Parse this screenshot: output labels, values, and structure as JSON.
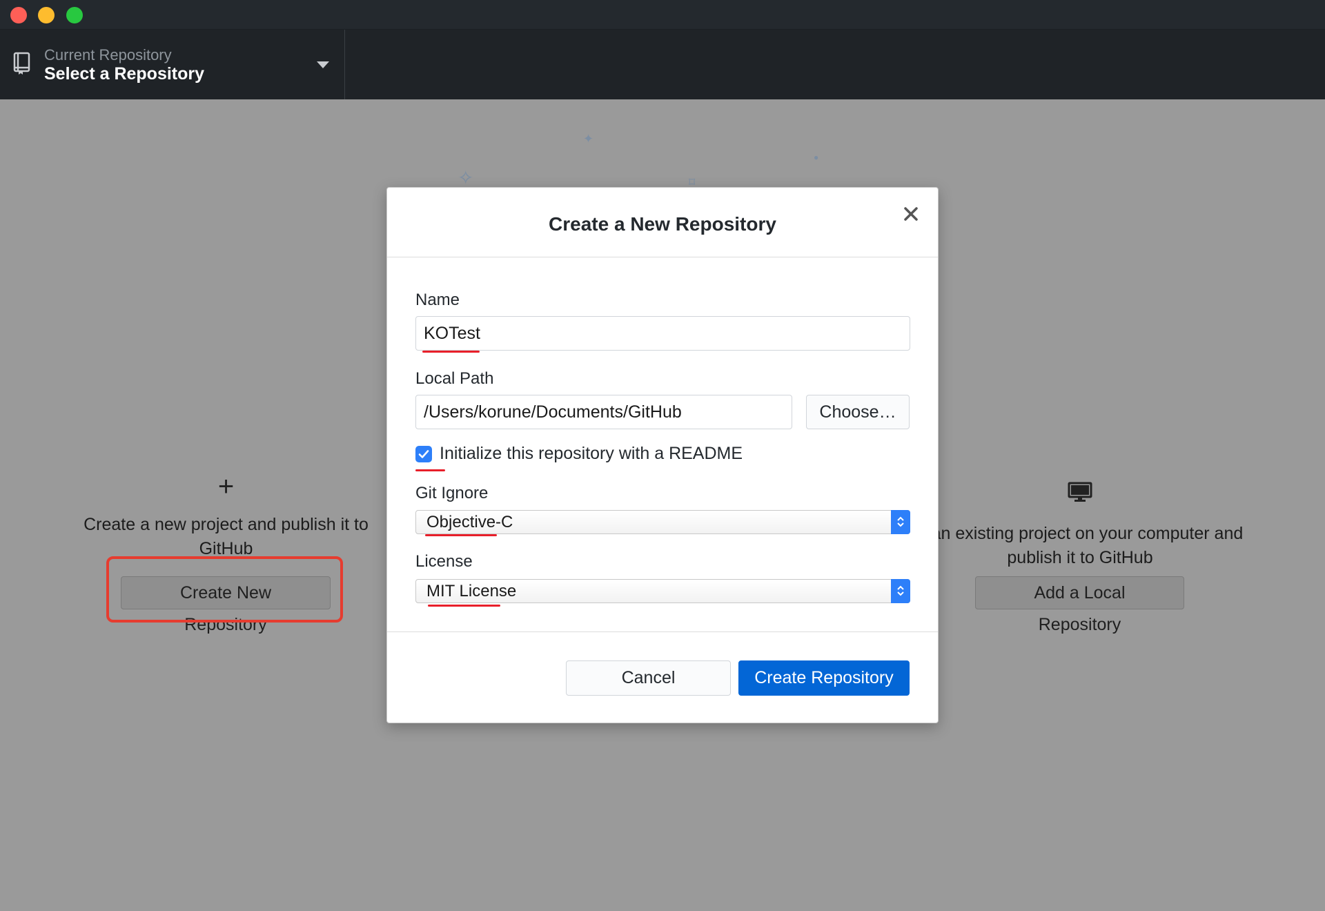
{
  "toolbar": {
    "repo_caption": "Current Repository",
    "repo_title": "Select a Repository"
  },
  "blank_slate": {
    "left": {
      "description": "Create a new project and publish it to GitHub",
      "button_label": "Create New Repository"
    },
    "right": {
      "description": "d an existing project on your computer and publish it to GitHub",
      "button_label": "Add a Local Repository"
    }
  },
  "dialog": {
    "title": "Create a New Repository",
    "name_label": "Name",
    "name_value": "KOTest",
    "path_label": "Local Path",
    "path_value": "/Users/korune/Documents/GitHub",
    "choose_label": "Choose…",
    "readme_label": "Initialize this repository with a README",
    "readme_checked": true,
    "gitignore_label": "Git Ignore",
    "gitignore_value": "Objective-C",
    "license_label": "License",
    "license_value": "MIT License",
    "cancel_label": "Cancel",
    "create_label": "Create Repository"
  },
  "colors": {
    "primary_button": "#0366d6",
    "checkbox": "#2d7ff9",
    "annotation": "#e81f2a"
  }
}
